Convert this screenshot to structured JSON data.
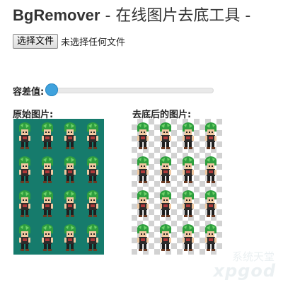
{
  "header": {
    "brand": "BgRemover",
    "separator": " - ",
    "subtitle": "在线图片去底工具 -"
  },
  "file_input": {
    "button_label": "选择文件",
    "status_text": "未选择任何文件"
  },
  "tolerance": {
    "label": "容差值:",
    "value": 0,
    "accent_color": "#3fa2dd"
  },
  "images": {
    "original_label": "原始图片:",
    "result_label": "去底后的图片:",
    "original_background": "#167b6c",
    "result_background": "transparent-checkerboard",
    "sprite_grid": {
      "rows": 4,
      "cols": 4
    },
    "sprite_description": "green-haired character sprite sheet, four facing directions"
  },
  "watermark": {
    "chinese_text": "系统天堂",
    "latin_text": "xpgod"
  }
}
